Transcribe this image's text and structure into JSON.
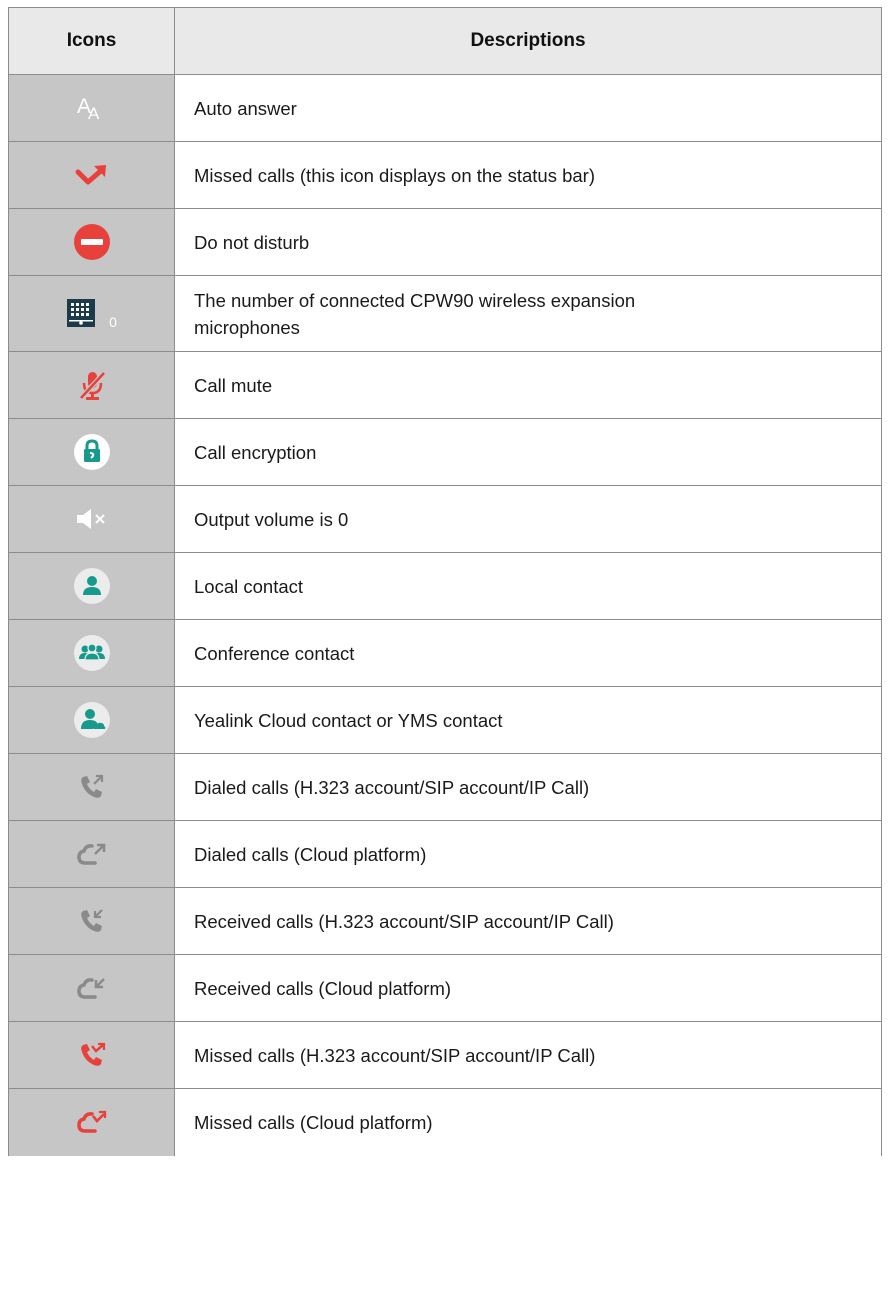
{
  "table": {
    "header": {
      "icons": "Icons",
      "descriptions": "Descriptions"
    },
    "rows": [
      {
        "icon": "auto-answer-icon",
        "description": "Auto answer"
      },
      {
        "icon": "missed-call-arrow-icon",
        "description": "Missed calls (this icon displays on the status bar)"
      },
      {
        "icon": "do-not-disturb-icon",
        "description": "Do not disturb"
      },
      {
        "icon": "wireless-mic-count-icon",
        "icon_count": "0",
        "description": "The number of connected CPW90 wireless expansion microphones"
      },
      {
        "icon": "call-mute-icon",
        "description": "Call mute"
      },
      {
        "icon": "call-encryption-icon",
        "description": "Call encryption"
      },
      {
        "icon": "volume-muted-icon",
        "description": "Output volume is 0"
      },
      {
        "icon": "local-contact-icon",
        "description": "Local contact"
      },
      {
        "icon": "conference-contact-icon",
        "description": "Conference contact"
      },
      {
        "icon": "cloud-contact-icon",
        "description": "Yealink Cloud contact or YMS contact"
      },
      {
        "icon": "dialed-call-icon",
        "description": "Dialed calls (H.323 account/SIP account/IP Call)"
      },
      {
        "icon": "dialed-cloud-call-icon",
        "description": "Dialed calls (Cloud platform)"
      },
      {
        "icon": "received-call-icon",
        "description": "Received calls (H.323 account/SIP account/IP Call)"
      },
      {
        "icon": "received-cloud-call-icon",
        "description": "Received calls (Cloud platform)"
      },
      {
        "icon": "missed-call-icon",
        "description": "Missed calls (H.323 account/SIP account/IP Call)"
      },
      {
        "icon": "missed-cloud-call-icon",
        "description": "Missed calls (Cloud platform)"
      }
    ]
  },
  "colors": {
    "icon_cell_bg": "#c6c6c6",
    "header_bg": "#e9e9e9",
    "red": "#e8403b",
    "teal": "#179a8c",
    "gray_icon": "#8a8a8a"
  }
}
